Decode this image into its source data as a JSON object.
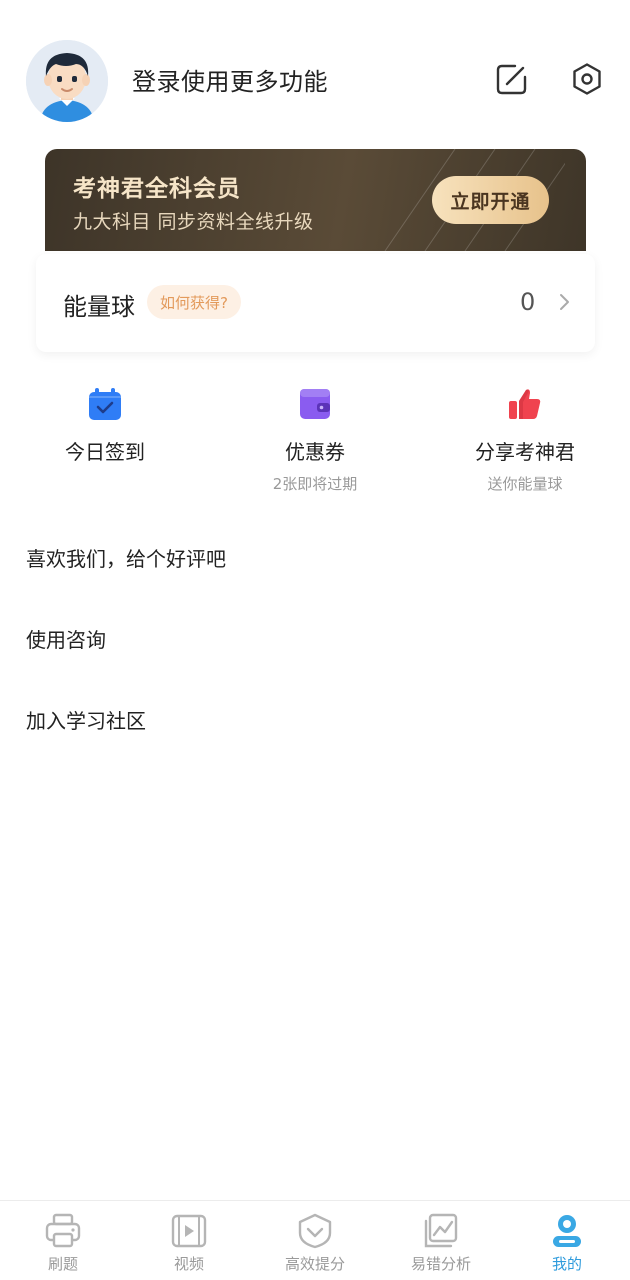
{
  "header": {
    "login_text": "登录使用更多功能",
    "icons": [
      "edit-icon",
      "settings-icon"
    ]
  },
  "vip": {
    "title": "考神君全科会员",
    "subtitle": "九大科目 同步资料全线升级",
    "button": "立即开通"
  },
  "energy": {
    "label": "能量球",
    "tag": "如何获得?",
    "count": "0"
  },
  "quick_actions": [
    {
      "label": "今日签到",
      "sub": "",
      "icon": "calendar-check-icon",
      "color": "#2f7df6"
    },
    {
      "label": "优惠券",
      "sub": "2张即将过期",
      "icon": "wallet-icon",
      "color": "#8a5cf0"
    },
    {
      "label": "分享考神君",
      "sub": "送你能量球",
      "icon": "thumbs-up-icon",
      "color": "#f0434f"
    }
  ],
  "menu": [
    {
      "label": "喜欢我们，给个好评吧"
    },
    {
      "label": "使用咨询"
    },
    {
      "label": "加入学习社区"
    }
  ],
  "tabbar": {
    "active_index": 4,
    "tabs": [
      {
        "label": "刷题",
        "icon": "printer-icon"
      },
      {
        "label": "视频",
        "icon": "video-icon"
      },
      {
        "label": "高效提分",
        "icon": "heart-shield-icon"
      },
      {
        "label": "易错分析",
        "icon": "chart-icon"
      },
      {
        "label": "我的",
        "icon": "profile-icon"
      }
    ]
  },
  "colors": {
    "accent": "#2f9bdc",
    "vip_gold": "#e7c28b",
    "tag_orange": "#e39a5b"
  }
}
